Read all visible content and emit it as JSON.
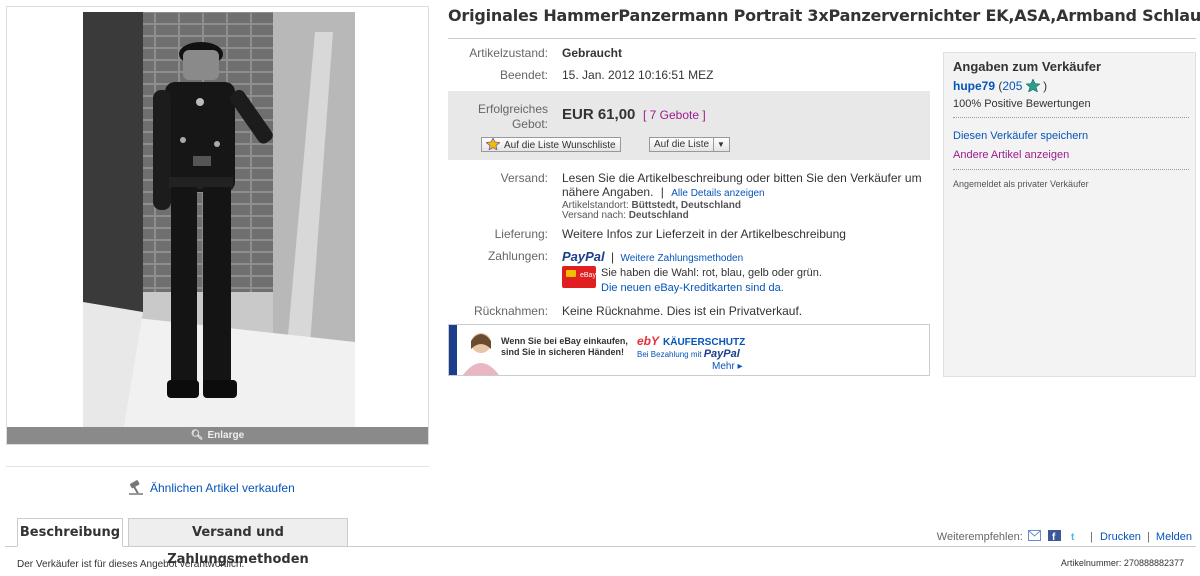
{
  "item": {
    "title": "Originales HammerPanzermann Portrait 3xPanzervernichter EK,ASA,Armband Schlaufen",
    "enlarge_label": "Enlarge",
    "sell_similar": "Ähnlichen Artikel verkaufen"
  },
  "details": {
    "condition_label": "Artikelzustand:",
    "condition_value": "Gebraucht",
    "ended_label": "Beendet:",
    "ended_value": "15. Jan. 2012 10:16:51 MEZ",
    "bid_label_line1": "Erfolgreiches",
    "bid_label_line2": "Gebot:",
    "price": "EUR 61,00",
    "bids": "[ 7 Gebote ]",
    "watchlist_button": "Auf die Liste Wunschliste",
    "list_button": "Auf die Liste",
    "shipping_label": "Versand:",
    "shipping_line1": "Lesen Sie die Artikelbeschreibung oder bitten Sie den Verkäufer um",
    "shipping_line2": "nähere Angaben.",
    "shipping_sep": "|",
    "shipping_details_link": "Alle Details anzeigen",
    "location_label": "Artikelstandort:",
    "location_value": "Büttstedt, Deutschland",
    "ships_to_label": "Versand nach:",
    "ships_to_value": "Deutschland",
    "delivery_label": "Lieferung:",
    "delivery_value": "Weitere Infos zur Lieferzeit in der Artikelbeschreibung",
    "payment_label": "Zahlungen:",
    "paypal": "PayPal",
    "payment_sep": "|",
    "more_payment_link": "Weitere Zahlungsmethoden",
    "card_text": "Sie haben die Wahl: rot, blau, gelb oder grün.",
    "card_link": "Die neuen eBay-Kreditkarten sind da.",
    "returns_label": "Rücknahmen:",
    "returns_value": "Keine Rücknahme. Dies ist ein Privatverkauf."
  },
  "banner": {
    "line1": "Wenn Sie bei eBay einkaufen,",
    "line2": "sind Sie in sicheren Händen!",
    "ebay": "ebY",
    "title": "KÄUFERSCHUTZ",
    "pay_text": "Bei Bezahlung mit",
    "paypal": "PayPal",
    "more": "Mehr ▸"
  },
  "seller": {
    "heading": "Angaben zum Verkäufer",
    "name": "hupe79",
    "score_open": "(",
    "score": "205",
    "score_close": ")",
    "positive": "100% Positive Bewertungen",
    "save_seller": "Diesen Verkäufer speichern",
    "other_items": "Andere Artikel anzeigen",
    "note": "Angemeldet als privater Verkäufer",
    "star_color": "#2a9d8f"
  },
  "tabs": [
    {
      "label": "Beschreibung"
    },
    {
      "label": "Versand und Zahlungsmethoden"
    }
  ],
  "share": {
    "label": "Weiterempfehlen:",
    "print": "Drucken",
    "report": "Melden"
  },
  "footer": {
    "responsibility": "Der Verkäufer ist für dieses Angebot verantwortlich.",
    "item_number": "Artikelnummer: 270888882377"
  }
}
